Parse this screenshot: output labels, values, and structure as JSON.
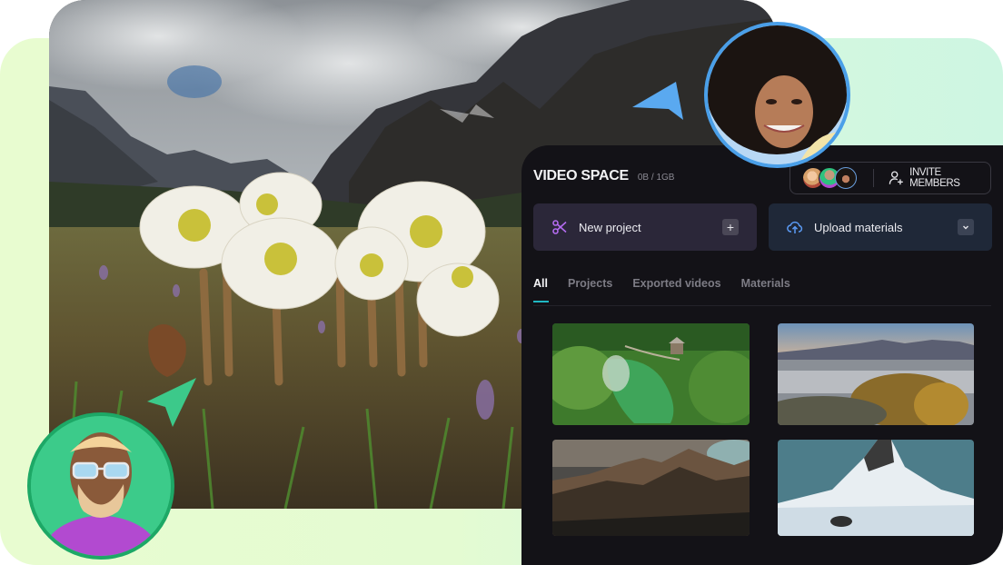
{
  "app": {
    "title": "VIDEO SPACE",
    "quota": "0B / 1GB",
    "invite_label": "INVITE MEMBERS",
    "member_avatars": [
      "member-1",
      "member-2",
      "member-3"
    ],
    "actions": [
      {
        "label": "New project",
        "icon": "scissors-icon",
        "trailing": "+",
        "trailing_icon": "plus-icon",
        "icon_color": "#b46cf0"
      },
      {
        "label": "Upload materials",
        "icon": "cloud-upload-icon",
        "trailing": "⌄",
        "trailing_icon": "chevron-down-icon",
        "icon_color": "#5b9bf5"
      }
    ],
    "tabs": [
      {
        "label": "All",
        "active": true
      },
      {
        "label": "Projects",
        "active": false
      },
      {
        "label": "Exported videos",
        "active": false
      },
      {
        "label": "Materials",
        "active": false
      }
    ],
    "thumbnails": [
      {
        "subject": "aerial green forest spring with gazebo"
      },
      {
        "subject": "misty autumn valley with mountains and town"
      },
      {
        "subject": "rugged mountain ridge at dusk"
      },
      {
        "subject": "snow-covered conical mountain"
      }
    ]
  },
  "hero": {
    "subject": "white hellebore flowers in alpine meadow with mountains"
  },
  "collaborators": [
    {
      "name": "woman-avatar",
      "ring_color": "#4a9fe8",
      "cursor_color": "#5aa9f0"
    },
    {
      "name": "man-avatar",
      "ring_color": "#1da866",
      "cursor_color": "#3cc98a"
    }
  ],
  "colors": {
    "accent_tab": "#1fb8c3",
    "panel_bg": "#131217"
  }
}
